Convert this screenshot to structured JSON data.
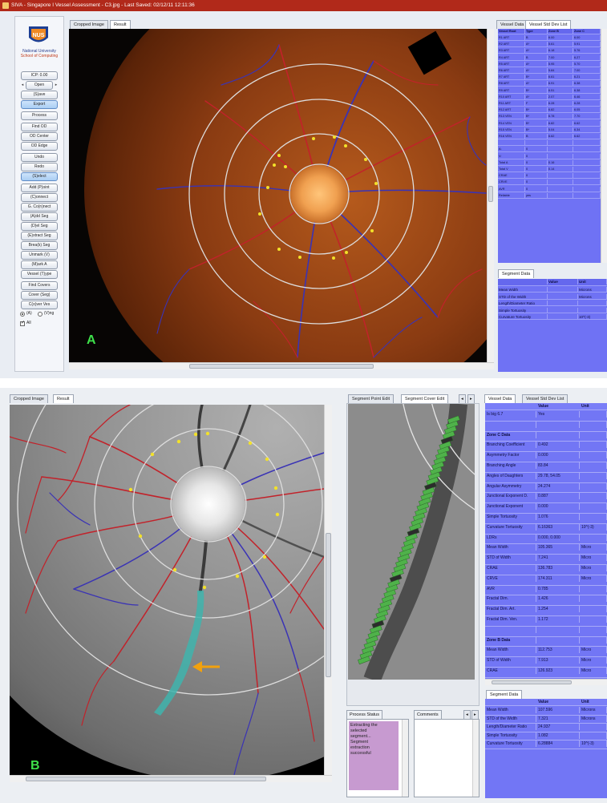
{
  "panel_a": {
    "window_title": "SIVA - Singapore I Vessel Assessment - C3.jpg - Last Saved: 02/12/11 12:11:36",
    "logo": {
      "line1": "NUS",
      "line2": "National University",
      "line3": "School of Computing"
    },
    "sidebar_buttons": [
      "ICP: 0.00",
      "Open",
      "(S)ave",
      "Export",
      "Process",
      "Find OD",
      "OD Center",
      "OD Edge",
      "Undo",
      "Redo",
      "(S)elect",
      "Add (P)oint",
      "(C)onnect",
      "G. Co(n)nect",
      "(A)dd Seg",
      "(D)el Seg",
      "(E)xtract Seg",
      "Brea(k) Seg",
      "Unmark (V)",
      "(M)ark A",
      "Vessel (T)ype",
      "Find Covers",
      "Cover (Seg)",
      "C(o)ver Ves"
    ],
    "radio_options": [
      "(A)",
      "(V)ng"
    ],
    "checkbox_label": "All",
    "image_tabs": [
      "Cropped Image",
      "Result"
    ],
    "table_tabs": [
      "Vessel Data",
      "Vessel Std Dev List"
    ],
    "table_headers": [
      "Vessel Root",
      "Type",
      "Zone B",
      "Zone C"
    ],
    "table_rows": [
      [
        "R1 ART",
        "B",
        "6.00",
        "6.00"
      ],
      [
        "R2 ART",
        "A*",
        "5.61",
        "5.91"
      ],
      [
        "R3 ART",
        "A*",
        "6.18",
        "5.76"
      ],
      [
        "R4 ART",
        "B",
        "7.00",
        "6.27"
      ],
      [
        "R5 ART",
        "A*",
        "5.95",
        "5.70"
      ],
      [
        "R6 ART",
        "A*",
        "5.84",
        "7.00"
      ],
      [
        "R7 ART",
        "B*",
        "6.61",
        "6.21"
      ],
      [
        "R8 ART",
        "A*",
        "6.91",
        "6.38"
      ],
      [
        "R9 ART",
        "B*",
        "6.51",
        "6.38"
      ],
      [
        "R10 ART",
        "A*",
        "2.07",
        "6.46"
      ],
      [
        "R11 ART",
        "F",
        "6.28",
        "6.28"
      ],
      [
        "R12 ART",
        "B*",
        "6.82",
        "6.05"
      ],
      [
        "R13 VEN",
        "B*",
        "6.78",
        "7.70"
      ],
      [
        "R14 VEN",
        "B*",
        "6.82",
        "6.62"
      ],
      [
        "R15 VEN",
        "B*",
        "5.04",
        "6.34"
      ],
      [
        "R16 VEN",
        "B",
        "6.62",
        "6.62"
      ],
      [
        "",
        "",
        "",
        ""
      ],
      [
        "A:",
        "0",
        "",
        ""
      ],
      [
        "V:",
        "0",
        "",
        ""
      ],
      [
        "Total A",
        "0",
        "0.16",
        ""
      ],
      [
        "Total V",
        "0",
        "0.14",
        ""
      ],
      [
        "CRAE",
        "0",
        "",
        ""
      ],
      [
        "CRVE",
        "0",
        "",
        ""
      ],
      [
        "AVR",
        "0",
        "",
        ""
      ],
      [
        "Reliable",
        "yes",
        "",
        ""
      ]
    ],
    "segment_tab": "Segment Data",
    "segment_headers": [
      "",
      "Value",
      "Unit"
    ],
    "segment_rows": [
      [
        "Mean Width",
        "",
        "Microns"
      ],
      [
        "STD of the Width",
        "",
        "Microns"
      ],
      [
        "Length/Diameter Ratio",
        "",
        ""
      ],
      [
        "Simple Tortuosity",
        "",
        ""
      ],
      [
        "Curvature Tortuosity",
        "",
        "10^(-3)"
      ]
    ],
    "label": "A"
  },
  "panel_b": {
    "image_tabs": [
      "Cropped Image",
      "Result"
    ],
    "seg_tabs": [
      "Segment Point Edit",
      "Segment Cover Edit"
    ],
    "seg_tab_arrows": [
      "◂",
      "▸"
    ],
    "process_status": {
      "title": "Process Status",
      "lines": [
        "Extracting the",
        "selected",
        "segment...",
        "Segment",
        "extraction",
        "successful"
      ]
    },
    "comments": {
      "title": "Comments",
      "arrows": [
        "◂",
        "▸"
      ]
    },
    "vessel_tabs": [
      "Vessel Data",
      "Vessel Std Dev List"
    ],
    "vessel_headers": [
      "",
      "Value",
      "Unit"
    ],
    "vessel_rows": [
      [
        "Is big 6.7",
        "Yes",
        ""
      ],
      [
        "",
        "",
        ""
      ],
      [
        "Zone C Data",
        "",
        ""
      ],
      [
        "Branching Coefficient",
        "0.492",
        ""
      ],
      [
        "Asymmetry Factor",
        "0.000",
        ""
      ],
      [
        "Branching Angle",
        "83.84",
        ""
      ],
      [
        "Angles of Daughters",
        "29.78, 54.05",
        ""
      ],
      [
        "Angular Asymmetry",
        "24.274",
        ""
      ],
      [
        "Junctional Exponent D.",
        "0.887",
        ""
      ],
      [
        "Junctional Exponent",
        "0.000",
        ""
      ],
      [
        "Simple Tortuosity",
        "1.076",
        ""
      ],
      [
        "Curvature Tortuosity",
        "6.16363",
        "10^(-3)"
      ],
      [
        "LDRs",
        "0.000, 0.000",
        ""
      ],
      [
        "Mean Width",
        "105.365",
        "Micro"
      ],
      [
        "STD of Width",
        "7.241",
        "Micro"
      ],
      [
        "CRAE",
        "136.783",
        "Micro"
      ],
      [
        "CRVE",
        "174.311",
        "Micro"
      ],
      [
        "AVR",
        "0.785",
        ""
      ],
      [
        "Fractal Dim.",
        "1.426",
        ""
      ],
      [
        "Fractal Dim. Art.",
        "1.254",
        ""
      ],
      [
        "Fractal Dim. Ven.",
        "1.172",
        ""
      ],
      [
        "",
        "",
        ""
      ],
      [
        "Zone B Data",
        "",
        ""
      ],
      [
        "Mean Width",
        "112.753",
        "Micro"
      ],
      [
        "STD of Width",
        "7.913",
        "Micro"
      ],
      [
        "CRAE",
        "126.923",
        "Micro"
      ]
    ],
    "segment_tab": "Segment Data",
    "segment_headers": [
      "",
      "Value",
      "Unit"
    ],
    "segment_rows": [
      [
        "Mean Width",
        "107.596",
        "Microns"
      ],
      [
        "STD of the Width",
        "7.321",
        "Microns"
      ],
      [
        "Length/Diameter Ratio",
        "24.937",
        ""
      ],
      [
        "Simple Tortuosity",
        "1.082",
        ""
      ],
      [
        "Curvature Tortuosity",
        "6.28884",
        "10^(-3)"
      ]
    ],
    "label": "B"
  },
  "colors": {
    "titlebar": "#b1291a",
    "table_blue": "#6f72f4",
    "artery": "#c2222a",
    "vein": "#3a33b5",
    "ring": "#dddddd",
    "marker": "#f2e12a",
    "panel_label": "#3ee04a",
    "arrow": "#f2a10d",
    "process_status_bg": "#c79ad0",
    "segment_fill": "#4fb24a"
  }
}
